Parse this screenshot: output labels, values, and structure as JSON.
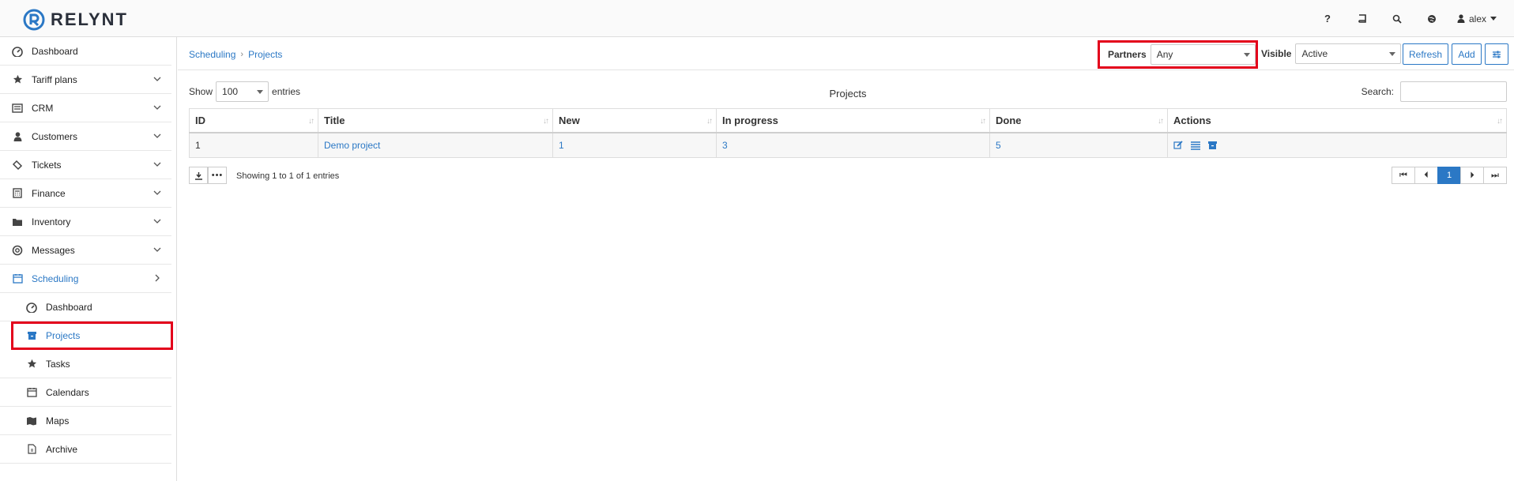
{
  "app": {
    "brand": "RELYNT"
  },
  "topbar": {
    "icons": [
      "help-icon",
      "book-icon",
      "search-icon",
      "globe-icon"
    ],
    "help_label": "?",
    "user": "alex"
  },
  "sidebar": {
    "items": [
      {
        "label": "Dashboard",
        "icon": "dashboard-icon",
        "chevron": ""
      },
      {
        "label": "Tariff plans",
        "icon": "star-icon",
        "chevron": "down"
      },
      {
        "label": "CRM",
        "icon": "crm-icon",
        "chevron": "down"
      },
      {
        "label": "Customers",
        "icon": "user-icon",
        "chevron": "down"
      },
      {
        "label": "Tickets",
        "icon": "ticket-icon",
        "chevron": "down"
      },
      {
        "label": "Finance",
        "icon": "calculator-icon",
        "chevron": "down"
      },
      {
        "label": "Inventory",
        "icon": "folder-icon",
        "chevron": "down"
      },
      {
        "label": "Messages",
        "icon": "lifebuoy-icon",
        "chevron": "down"
      },
      {
        "label": "Scheduling",
        "icon": "calendar-icon",
        "chevron": "right"
      }
    ],
    "sub_items": [
      {
        "label": "Dashboard",
        "icon": "dashboard-icon"
      },
      {
        "label": "Projects",
        "icon": "archive-box-icon"
      },
      {
        "label": "Tasks",
        "icon": "star-icon"
      },
      {
        "label": "Calendars",
        "icon": "calendar-icon"
      },
      {
        "label": "Maps",
        "icon": "map-icon"
      },
      {
        "label": "Archive",
        "icon": "file-icon"
      }
    ]
  },
  "breadcrumb": {
    "parent": "Scheduling",
    "current": "Projects"
  },
  "filters": {
    "partners_label": "Partners",
    "partners_value": "Any",
    "visible_label": "Visible",
    "visible_value": "Active"
  },
  "buttons": {
    "refresh": "Refresh",
    "add": "Add"
  },
  "table": {
    "show_label": "Show",
    "entries_value": "100",
    "entries_label": "entries",
    "title": "Projects",
    "search_label": "Search:",
    "columns": [
      "ID",
      "Title",
      "New",
      "In progress",
      "Done",
      "Actions"
    ],
    "rows": [
      {
        "id": "1",
        "title": "Demo project",
        "new": "1",
        "in_progress": "3",
        "done": "5"
      }
    ],
    "showing": "Showing 1 to 1 of 1 entries",
    "page": "1"
  },
  "colors": {
    "accent": "#2b78c5",
    "highlight": "#e3001b"
  }
}
